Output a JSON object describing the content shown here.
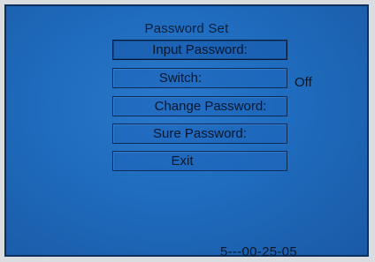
{
  "header": {
    "title": "Password Set"
  },
  "menu": {
    "items": [
      {
        "label": "Input Password:"
      },
      {
        "label": "Switch:",
        "value": "Off"
      },
      {
        "label": "Change Password:"
      },
      {
        "label": "Sure Password:"
      },
      {
        "label": "Exit"
      }
    ],
    "selected_index": 0
  },
  "footer": {
    "code": "5---00-25-05"
  },
  "colors": {
    "background": "#1f6bbd",
    "text": "#07172e",
    "border": "#0c2c57"
  }
}
